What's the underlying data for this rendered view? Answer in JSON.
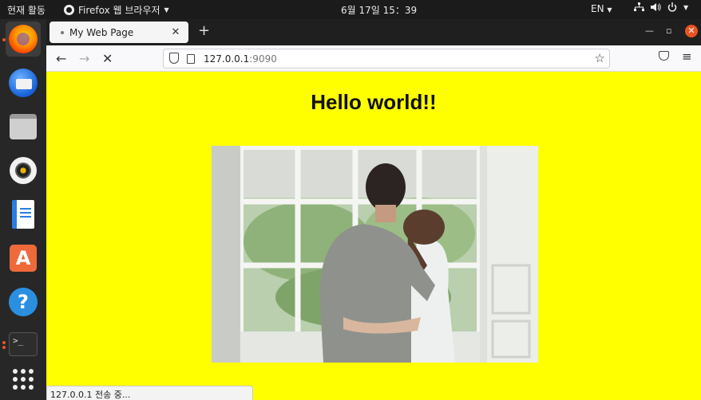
{
  "topbar": {
    "activities": "현재 활동",
    "app_menu": "Firefox 웹 브라우저",
    "clock": "6월 17일  15：39",
    "lang": "EN"
  },
  "dock": {
    "items": [
      "firefox",
      "thunderbird",
      "files",
      "rhythmbox",
      "libreoffice-writer",
      "software-store",
      "help",
      "terminal",
      "show-apps"
    ]
  },
  "browser": {
    "tab_title": "My Web Page",
    "url_host": "127.0.0.1",
    "url_port": ":9090"
  },
  "page": {
    "heading": "Hello world!!",
    "image": "couple-at-window"
  },
  "status_text": "127.0.0.1 전송 중..."
}
